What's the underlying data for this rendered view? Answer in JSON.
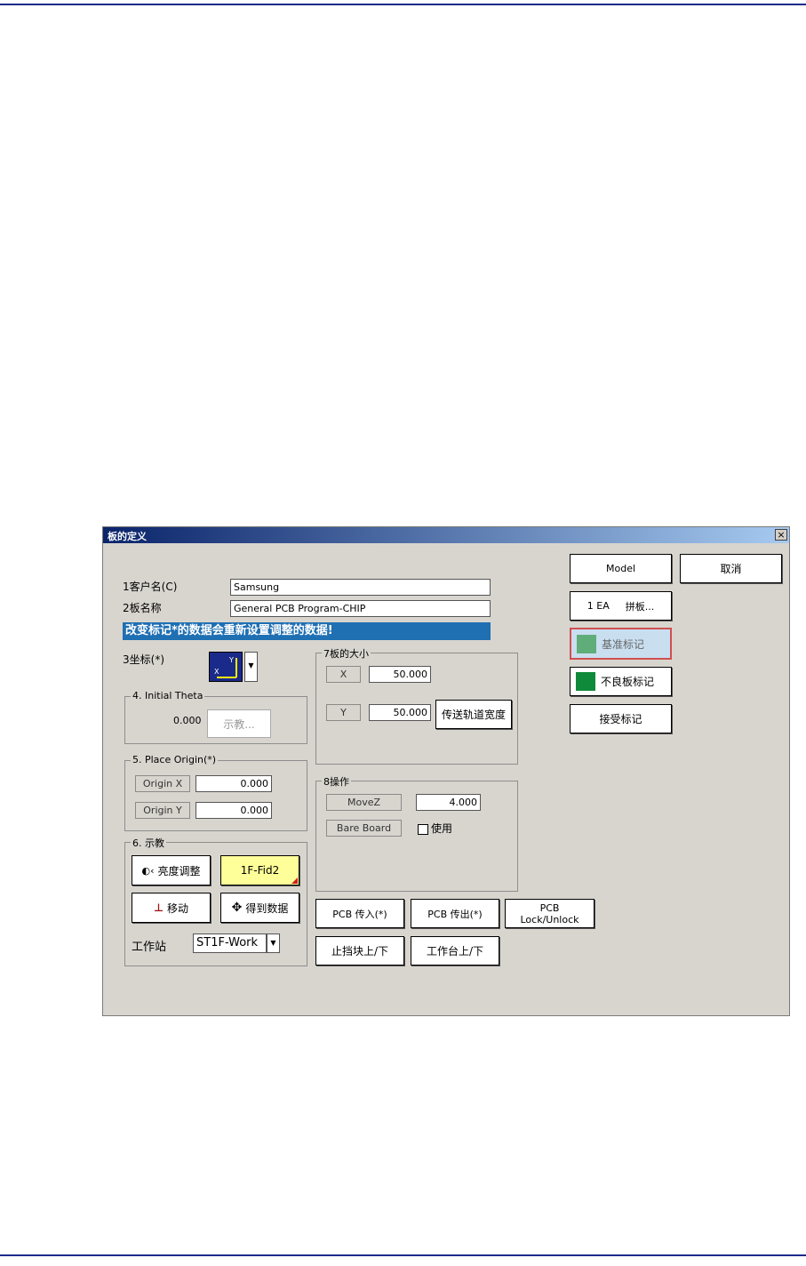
{
  "window": {
    "title": "板的定义",
    "close": "×"
  },
  "fields": {
    "customer_label": "1客户名(C)",
    "customer_value": "Samsung",
    "board_label": "2板名称",
    "board_value": "General PCB Program-CHIP",
    "warning": "改变标记*的数据会重新设置调整的数据!"
  },
  "coord": {
    "label": "3坐标(*)",
    "axis_y": "Y",
    "axis_x": "X"
  },
  "initial_theta": {
    "legend": "4. Initial Theta",
    "value": "0.000",
    "teach_button": "示教..."
  },
  "place_origin": {
    "legend": "5. Place Origin(*)",
    "x_label": "Origin X",
    "x_value": "0.000",
    "y_label": "Origin Y",
    "y_value": "0.000"
  },
  "teach": {
    "legend": "6. 示教",
    "brightness_button": "亮度调整",
    "fid_button": "1F-Fid2",
    "move_button": "移动",
    "get_data_button": "得到数据",
    "station_label": "工作站",
    "station_value": "ST1F-Work"
  },
  "board_size": {
    "legend": "7板的大小",
    "x_label": "X",
    "x_value": "50.000",
    "y_label": "Y",
    "y_value": "50.000",
    "transfer_button": "传送轨道宽度"
  },
  "operation": {
    "legend": "8操作",
    "movez_label": "MoveZ",
    "movez_value": "4.000",
    "bare_board_label": "Bare Board",
    "use_label": "使用"
  },
  "bottom_buttons": {
    "pcb_in": "PCB 传入(*)",
    "pcb_out": "PCB 传出(*)",
    "pcb_lock_line1": "PCB",
    "pcb_lock_line2": "Lock/Unlock",
    "stopper": "止挡块上/下",
    "table": "工作台上/下"
  },
  "right_buttons": {
    "model": "Model",
    "cancel": "取消",
    "array_count": "1 EA",
    "array_label": "拼板...",
    "fiducial": "基准标记",
    "bad_mark": "不良板标记",
    "accept_mark": "接受标记"
  },
  "colors": {
    "banner": "#1f6fb3",
    "fid_yellow": "#ffff99",
    "fiducial_swatch": "#5fae7a",
    "bad_mark_swatch": "#0f8a3a",
    "fiducial_border": "#d05050"
  }
}
